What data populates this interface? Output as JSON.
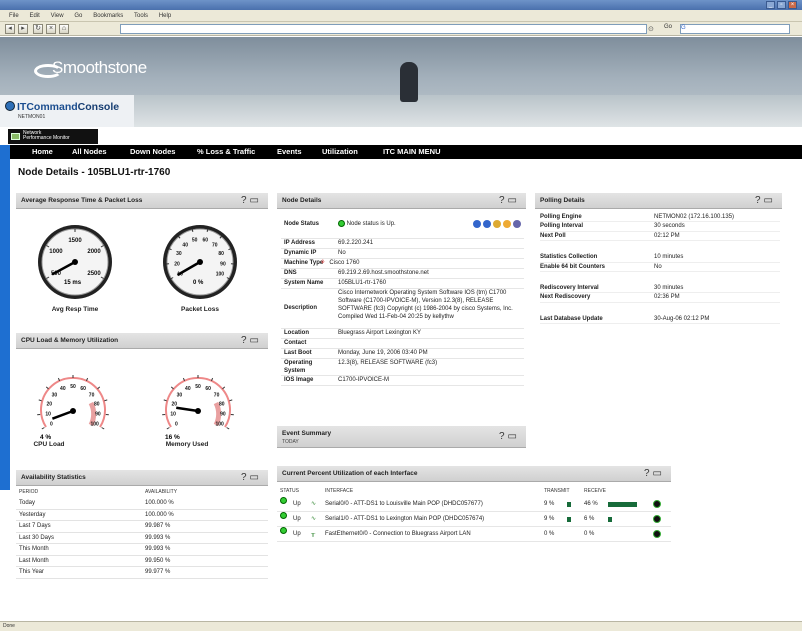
{
  "browser": {
    "menu": [
      "File",
      "Edit",
      "View",
      "Go",
      "Bookmarks",
      "Tools",
      "Help"
    ],
    "go_label": "Go",
    "search_value": "G"
  },
  "banner": {
    "logo": "Smoothstone",
    "console_title_a": "ITCommand",
    "console_title_b": "Console",
    "console_sub": "NETMON01"
  },
  "npm_tab": {
    "line1": "Network",
    "line2": "Performance Monitor"
  },
  "menu": [
    "Home",
    "All Nodes",
    "Down Nodes",
    "% Loss & Traffic",
    "Events",
    "Utilization",
    "ITC MAIN MENU"
  ],
  "page_title": "Node Details - 105BLU1-rtr-1760",
  "panels": {
    "response": {
      "title": "Average Response Time & Packet Loss",
      "g1_label": "Avg Resp Time",
      "g2_label": "Packet Loss",
      "g1_unit": "ms",
      "g1_value": 15,
      "g2_value": 0,
      "g1_ticks": [
        "500",
        "1000",
        "1500",
        "2000",
        "2500"
      ],
      "g2_ticks": [
        "10",
        "20",
        "30",
        "40",
        "50",
        "60",
        "70",
        "80",
        "90",
        "100"
      ]
    },
    "cpu": {
      "title": "CPU Load & Memory Utilization",
      "g1_label": "CPU Load",
      "g2_label": "Memory Used",
      "g1_value": 4,
      "g2_value": 16,
      "ticks": [
        "0",
        "10",
        "20",
        "30",
        "40",
        "50",
        "60",
        "70",
        "80",
        "90",
        "100"
      ]
    },
    "availability": {
      "title": "Availability Statistics",
      "headers": [
        "PERIOD",
        "AVAILABILITY"
      ],
      "rows": [
        [
          "Today",
          "100.000 %"
        ],
        [
          "Yesterday",
          "100.000 %"
        ],
        [
          "Last 7 Days",
          "99.987 %"
        ],
        [
          "Last 30 Days",
          "99.993 %"
        ],
        [
          "This Month",
          "99.993 %"
        ],
        [
          "Last Month",
          "99.950 %"
        ],
        [
          "This Year",
          "99.977 %"
        ]
      ]
    },
    "node": {
      "title": "Node Details",
      "status": "Node status is Up.",
      "rows": [
        [
          "Node Status",
          ""
        ],
        [
          "IP Address",
          "69.2.220.241"
        ],
        [
          "Dynamic IP",
          "No"
        ],
        [
          "Machine Type",
          "Cisco 1760"
        ],
        [
          "DNS",
          "69.219.2.69.host.smoothstone.net"
        ],
        [
          "System Name",
          "105BLU1-rtr-1760"
        ],
        [
          "Description",
          "Cisco Internetwork Operating System Software IOS (tm) C1700 Software (C1700-IPVOICE-M), Version 12.3(8), RELEASE SOFTWARE (fc3) Copyright (c) 1986-2004 by cisco Systems, Inc. Compiled Wed 11-Feb-04 20:25 by kellythw"
        ],
        [
          "Location",
          "Bluegrass Airport Lexington KY"
        ],
        [
          "Contact",
          ""
        ],
        [
          "Last Boot",
          "Monday, June 19, 2006 03:40 PM"
        ],
        [
          "Operating System",
          "12.3(8), RELEASE SOFTWARE (fc3)"
        ],
        [
          "IOS Image",
          "C1700-IPVOICE-M"
        ]
      ]
    },
    "events": {
      "title": "Event Summary",
      "sub": "TODAY"
    },
    "polling": {
      "title": "Polling Details",
      "rows": [
        [
          "Polling Engine",
          "NETMON02 (172.16.100.135)"
        ],
        [
          "Polling Interval",
          "30 seconds"
        ],
        [
          "Next Poll",
          "02:12 PM"
        ],
        [
          "",
          ""
        ],
        [
          "Statistics Collection",
          "10 minutes"
        ],
        [
          "Enable 64 bit Counters",
          "No"
        ],
        [
          "",
          ""
        ],
        [
          "Rediscovery Interval",
          "30 minutes"
        ],
        [
          "Next Rediscovery",
          "02:36 PM"
        ],
        [
          "",
          ""
        ],
        [
          "Last Database Update",
          "30-Aug-06 02:12 PM"
        ]
      ]
    },
    "interfaces": {
      "title": "Current Percent Utilization of each Interface",
      "headers": [
        "STATUS",
        "INTERFACE",
        "TRANSMIT",
        "RECEIVE"
      ],
      "rows": [
        {
          "status": "Up",
          "name": "Serial0/0 - ATT-DS1 to Louisville Main POP (DHDC057677)",
          "tx": "9 %",
          "rx": "46 %",
          "tx_frac": 0.09,
          "rx_frac": 0.46
        },
        {
          "status": "Up",
          "name": "Serial1/0 - ATT-DS1 to Lexington Main POP (DHDC057674)",
          "tx": "9 %",
          "rx": "6 %",
          "tx_frac": 0.09,
          "rx_frac": 0.06
        },
        {
          "status": "Up",
          "name": "FastEthernet0/0 - Connection to Bluegrass Airport LAN",
          "tx": "0 %",
          "rx": "0 %",
          "tx_frac": 0,
          "rx_frac": 0
        }
      ]
    }
  },
  "statusbar": "Done"
}
